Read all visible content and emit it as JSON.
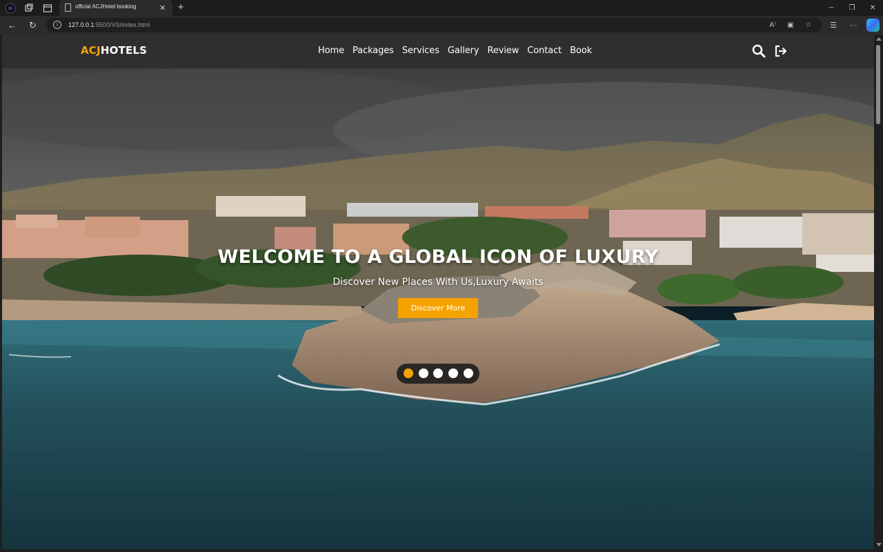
{
  "browser": {
    "tab_title": "official ACJHotel booking",
    "url_host": "127.0.0.1",
    "url_path": ":5500/VS/index.html"
  },
  "site": {
    "logo_part1": "ACJ",
    "logo_part2": "HOTELS",
    "nav": [
      "Home",
      "Packages",
      "Services",
      "Gallery",
      "Review",
      "Contact",
      "Book"
    ],
    "icons": [
      "search-icon",
      "logout-icon"
    ]
  },
  "hero": {
    "title": "WELCOME TO A GLOBAL ICON OF LUXURY",
    "subtitle": "Discover New Places With Us,Luxury Awaits",
    "cta_label": "Discover More",
    "slides_total": 5,
    "slide_active": 1
  },
  "colors": {
    "accent": "#f5a300",
    "header_bg": "#2f2f2f"
  }
}
